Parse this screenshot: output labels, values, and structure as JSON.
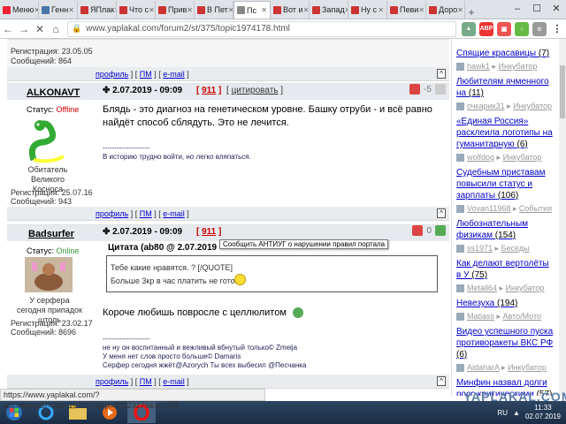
{
  "browser": {
    "tabs": [
      {
        "label": "Меню",
        "color": "#e23"
      },
      {
        "label": "Генн",
        "color": "#4a76a8"
      },
      {
        "label": "ЯПлак",
        "color": "#c33"
      },
      {
        "label": "Что с",
        "color": "#c33"
      },
      {
        "label": "Прив",
        "color": "#c33"
      },
      {
        "label": "В Пет",
        "color": "#c33"
      },
      {
        "label": "Пс",
        "color": "#888",
        "active": true
      },
      {
        "label": "Вот и",
        "color": "#c33"
      },
      {
        "label": "Запад",
        "color": "#c33"
      },
      {
        "label": "Ну с",
        "color": "#c33"
      },
      {
        "label": "Певи",
        "color": "#c33"
      },
      {
        "label": "Доро",
        "color": "#c33"
      }
    ],
    "url": "www.yaplakal.com/forum2/st/375/topic1974178.html",
    "status_url": "https://www.yaplakal.com/?act=report&f=2&t=1974178&p=82323279&st=375"
  },
  "posts": [
    {
      "reg_label": "Регистрация: 23.05.05",
      "msgs_label": "Сообщений: 864"
    },
    {
      "author": "ALKONAVT",
      "status_label": "Статус:",
      "status": "Offline",
      "rank": "Обитатель Великого Косноса",
      "reg_label": "Регистрация: 25.07.16",
      "msgs_label": "Сообщений: 943",
      "date": "2.07.2019 - 09:09",
      "num": "911",
      "cite": "цитировать",
      "score": "-5",
      "text": "Блядь - это диагноз на генетическом уровне. Башку отруби - и всё равно найдёт способ сблядуть. Это не лечится.",
      "sig_line": "--------------------",
      "sig": "В историю трудно войти, но легко вляпаться."
    },
    {
      "author": "Badsurfer",
      "status_label": "Статус:",
      "status": "Online",
      "rank": "У серфера сегодня припадок штоль",
      "reg_label": "Регистрация: 23.02.17",
      "msgs_label": "Сообщений: 8696",
      "date": "2.07.2019 - 09:09",
      "num": "911",
      "score": "0",
      "tooltip": "Сообщить АНТИУГ о нарушении правил портала",
      "quote_header": "Цитата (ab80 @ 2.07.2019",
      "quote_line1": "Тебе какие нравятся. ? [/QUOTE]",
      "quote_line2": "Больше 3кр в час платить не готов",
      "text": "Короче любишь повросле с целлюлитом",
      "sig_line": "--------------------",
      "sig1": "не ну он воспитанный и вежливый вбнутый только© Zmeija",
      "sig2": "У меня нет слов просто больше© Damaris",
      "sig3": "Серфер сегодня жжёт@Azorych Ты всех выбесил @Песчанка"
    }
  ],
  "footer_links": {
    "profile": "профиль",
    "pm": "ПМ",
    "email": "e-mail",
    "sep1": "[ ",
    "sep2": " ] [ ",
    "sep3": " ]",
    "up": "^"
  },
  "right_panel": [
    {
      "title": "Спящие красавицы",
      "count": "(7)",
      "author": "hawk1",
      "section": "Инкубатор"
    },
    {
      "title": "Любителям ячменного на",
      "count": "(11)",
      "author": "очкарик31",
      "section": "Инкубатор"
    },
    {
      "title": "«Единая Россия» расклеила логотипы на гуманитарную",
      "count": "(6)",
      "author": "wolfdog",
      "section": "Инкубатор"
    },
    {
      "title": "Судебным приставам повысили статус и зарплаты",
      "count": "(106)",
      "author": "Vovan11968",
      "section": "События"
    },
    {
      "title": "Любознательным физикам",
      "count": "(154)",
      "author": "ss1971",
      "section": "Беседы"
    },
    {
      "title": "Как делают вертолёты в У",
      "count": "(75)",
      "author": "Metall64",
      "section": "Инкубатор"
    },
    {
      "title": "Невезуха",
      "count": "(194)",
      "author": "Matiass",
      "section": "Авто/Мото"
    },
    {
      "title": "Видео успешного пуска противоракеты ВКС РФ",
      "count": "(6)",
      "author": "AidaharA",
      "section": "Инкубатор"
    },
    {
      "title": "Минфин назвал долги росс критическими",
      "count": "(57)",
      "author": "",
      "section": ""
    }
  ],
  "taskbar": {
    "lang": "RU",
    "time": "11:33",
    "date": "02.07.2019"
  },
  "watermark": "YAPLAKAL.COM"
}
